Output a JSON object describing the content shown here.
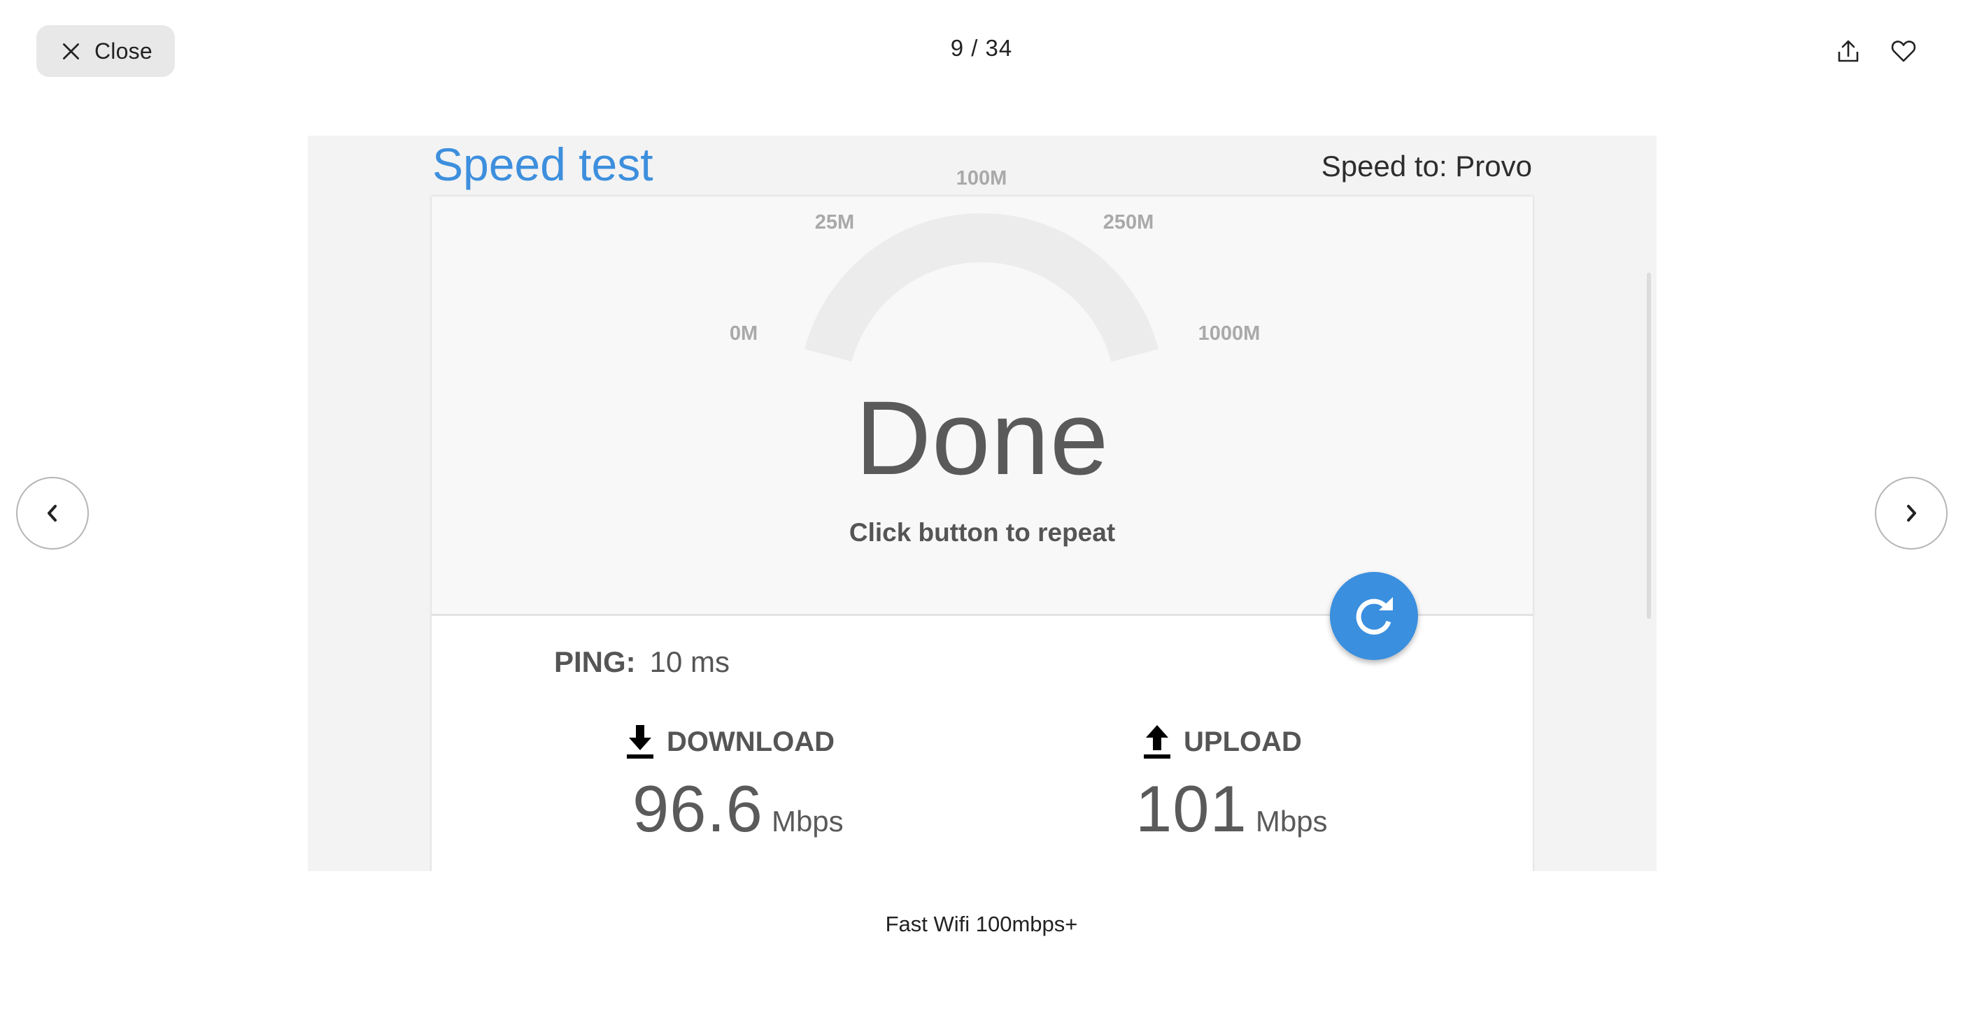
{
  "top_bar": {
    "close_label": "Close",
    "close_icon": "close-x-icon",
    "counter": "9 / 34",
    "share_icon": "share-icon",
    "favorite_icon": "heart-icon"
  },
  "navigation": {
    "prev_icon": "chevron-left-icon",
    "next_icon": "chevron-right-icon"
  },
  "photo": {
    "title": "Speed test",
    "speed_to": "Speed to: Provo",
    "gauge": {
      "labels": [
        "0M",
        "25M",
        "100M",
        "250M",
        "1000M"
      ],
      "track_color": "#ececec"
    },
    "status": "Done",
    "hint": "Click button to repeat",
    "refresh_icon": "refresh-icon",
    "accent_color": "#3a8fdf",
    "ping": {
      "label": "PING:",
      "value": "10 ms"
    },
    "download": {
      "label": "DOWNLOAD",
      "icon": "download-icon",
      "value": "96.6",
      "unit": "Mbps"
    },
    "upload": {
      "label": "UPLOAD",
      "icon": "upload-icon",
      "value": "101",
      "unit": "Mbps"
    }
  },
  "caption": "Fast Wifi 100mbps+"
}
